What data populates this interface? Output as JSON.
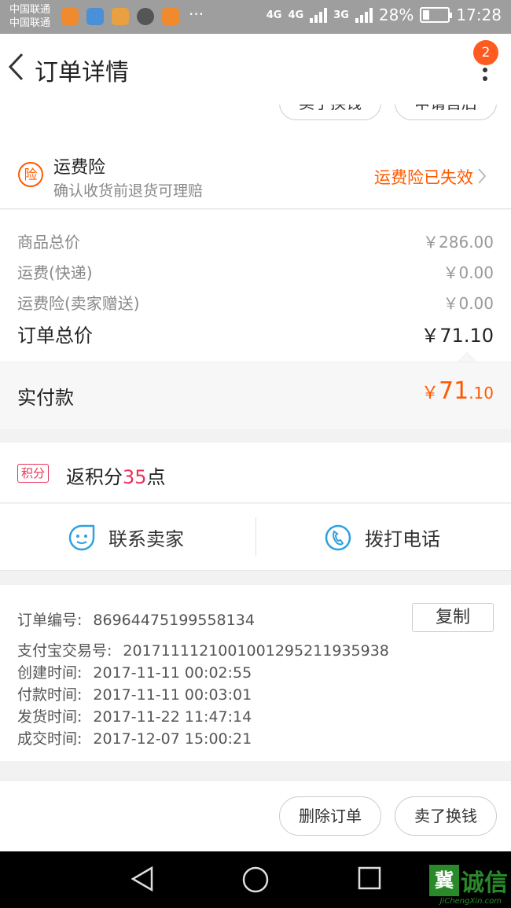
{
  "statusbar": {
    "carrier1": "中国联通",
    "carrier2": "中国联通",
    "net1": "4G",
    "net2": "4G",
    "net3": "3G",
    "battery": "28%",
    "time": "17:28",
    "battery_level": 0.28,
    "more": "···"
  },
  "header": {
    "title": "订单详情",
    "badge": "2"
  },
  "top_buttons": {
    "left": "卖了换钱",
    "right": "申请售后"
  },
  "insurance": {
    "icon_char": "险",
    "title": "运费险",
    "subtitle": "确认收货前退货可理赔",
    "status": "运费险已失效"
  },
  "price": {
    "rows": [
      {
        "label": "商品总价",
        "value": "￥286.00"
      },
      {
        "label": "运费(快递)",
        "value": "￥0.00"
      },
      {
        "label": "运费险(卖家赠送)",
        "value": "￥0.00"
      }
    ],
    "total_label": "订单总价",
    "total_value": "￥71.10"
  },
  "paid": {
    "label": "实付款",
    "currency": "￥",
    "integer": "71",
    "decimal": ".10"
  },
  "points": {
    "tag": "积分",
    "prefix": "返积分",
    "number": "35",
    "suffix": "点"
  },
  "contact": {
    "seller": "联系卖家",
    "phone": "拨打电话"
  },
  "order_info": {
    "copy_label": "复制",
    "rows": [
      {
        "key": "订单编号:",
        "value": "86964475199558134"
      },
      {
        "key": "支付宝交易号:",
        "value": "2017111121001001295211935938"
      },
      {
        "key": "创建时间:",
        "value": "2017-11-11 00:02:55"
      },
      {
        "key": "付款时间:",
        "value": "2017-11-11 00:03:01"
      },
      {
        "key": "发货时间:",
        "value": "2017-11-22 11:47:14"
      },
      {
        "key": "成交时间:",
        "value": "2017-12-07 15:00:21"
      }
    ]
  },
  "footer": {
    "delete": "删除订单",
    "sell": "卖了换钱"
  },
  "watermark": {
    "logo": "冀",
    "text": "诚信",
    "sub": "JiChengXin.com"
  },
  "colors": {
    "accent": "#ff5a00",
    "points": "#e8325a",
    "badge": "#ff5a1f",
    "contact_icon": "#2fa0e0",
    "watermark": "#2a8a2a"
  }
}
